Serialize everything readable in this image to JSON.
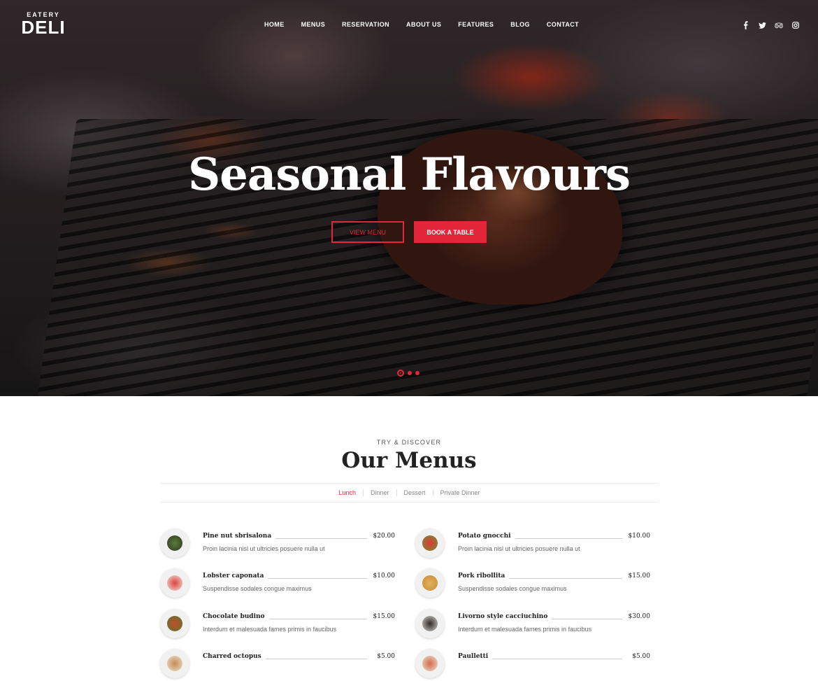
{
  "brand": {
    "top": "EATERY",
    "main": "DELI"
  },
  "nav": [
    "HOME",
    "MENUS",
    "RESERVATION",
    "ABOUT US",
    "FEATURES",
    "BLOG",
    "CONTACT"
  ],
  "social": [
    {
      "icon": "facebook-icon",
      "glyph": "f"
    },
    {
      "icon": "twitter-icon",
      "glyph": "🐦"
    },
    {
      "icon": "tripadvisor-icon",
      "glyph": "∞"
    },
    {
      "icon": "instagram-icon",
      "glyph": "◎"
    }
  ],
  "hero": {
    "title": "Seasonal Flavours",
    "btn_view": "VIEW MENU",
    "btn_book": "BOOK A TABLE",
    "slides": 3,
    "active_slide": 1
  },
  "menus": {
    "kicker": "TRY & DISCOVER",
    "title": "Our Menus",
    "tabs": [
      "Lunch",
      "Dinner",
      "Dessert",
      "Private Dinner"
    ],
    "active_tab": "Lunch",
    "left": [
      {
        "name": "Pine nut sbrisalona",
        "price": "$20.00",
        "desc": "Proin lacinia nisl ut ultricies posuere nulla ut"
      },
      {
        "name": "Lobster caponata",
        "price": "$10.00",
        "desc": "Suspendisse sodales congue maximus"
      },
      {
        "name": "Chocolate budino",
        "price": "$15.00",
        "desc": "Interdum et malesuada fames primis in faucibus"
      },
      {
        "name": "Charred octopus",
        "price": "$5.00",
        "desc": ""
      }
    ],
    "right": [
      {
        "name": "Potato gnocchi",
        "price": "$10.00",
        "desc": "Proin lacinia nisl ut ultricies posuere nulla ut"
      },
      {
        "name": "Pork ribollita",
        "price": "$15.00",
        "desc": "Suspendisse sodales congue maximus"
      },
      {
        "name": "Livorno style cacciuchino",
        "price": "$30.00",
        "desc": "Interdum et malesuada fames primis in faucibus"
      },
      {
        "name": "Paulletti",
        "price": "$5.00",
        "desc": ""
      }
    ]
  },
  "colors": {
    "accent": "#e3263a",
    "text": "#222222"
  }
}
